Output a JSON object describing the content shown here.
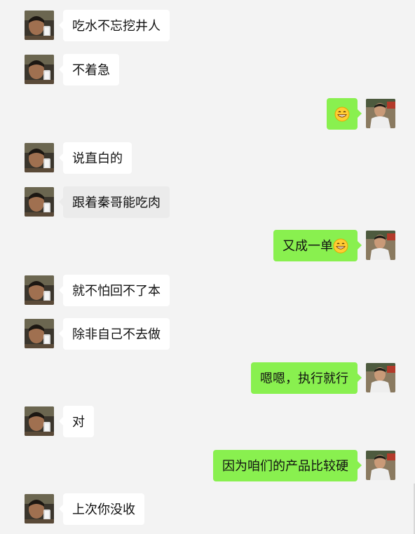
{
  "colors": {
    "background": "#f3f3f3",
    "incoming_bubble": "#ffffff",
    "outgoing_bubble": "#89f04f",
    "text": "#111111"
  },
  "messages": [
    {
      "side": "left",
      "text": "吃水不忘挖井人"
    },
    {
      "side": "left",
      "text": "不着急"
    },
    {
      "side": "right",
      "text": "",
      "emoji": "grinning-face-emoji"
    },
    {
      "side": "left",
      "text": "说直白的"
    },
    {
      "side": "left",
      "text": "跟着秦哥能吃肉"
    },
    {
      "side": "right",
      "text": "又成一单",
      "emoji": "grinning-face-emoji"
    },
    {
      "side": "left",
      "text": "就不怕回不了本"
    },
    {
      "side": "left",
      "text": "除非自己不去做"
    },
    {
      "side": "right",
      "text": "嗯嗯，执行就行"
    },
    {
      "side": "left",
      "text": "对"
    },
    {
      "side": "right",
      "text": "因为咱们的产品比较硬"
    },
    {
      "side": "left",
      "text": "上次你没收"
    }
  ]
}
